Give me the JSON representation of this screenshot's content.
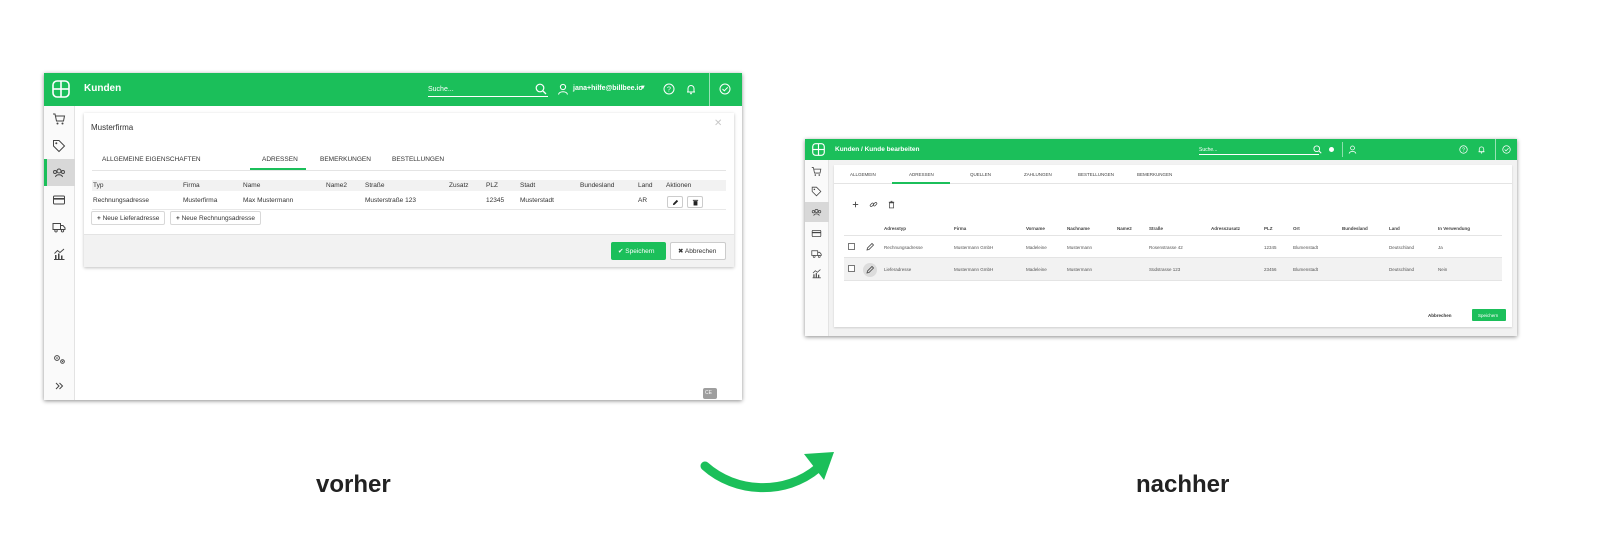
{
  "colors": {
    "brand_green": "#1bbf5a",
    "sidebar_active": "#d8d8d8",
    "header_row": "#f2f2f2"
  },
  "captions": {
    "before": "vorher",
    "after": "nachher"
  },
  "before": {
    "header": {
      "title": "Kunden",
      "search_placeholder": "Suche...",
      "user": "jana+hilfe@billbee.io"
    },
    "sidebar_icons": [
      "cart-icon",
      "tag-icon",
      "customers-icon",
      "credit-card-icon",
      "truck-icon",
      "analytics-icon",
      "settings-icon",
      "expand-icon"
    ],
    "panel": {
      "title": "Musterfirma",
      "tabs": [
        "ALLGEMEINE EIGENSCHAFTEN",
        "ADRESSEN",
        "BEMERKUNGEN",
        "BESTELLUNGEN"
      ],
      "active_tab": "ADRESSEN",
      "columns": [
        "Typ",
        "Firma",
        "Name",
        "Name2",
        "Straße",
        "Zusatz",
        "PLZ",
        "Stadt",
        "Bundesland",
        "Land",
        "Aktionen"
      ],
      "rows": [
        {
          "typ": "Rechnungsadresse",
          "firma": "Musterfirma",
          "name": "Max Mustermann",
          "name2": "",
          "strasse": "Musterstraße 123",
          "zusatz": "",
          "plz": "12345",
          "stadt": "Musterstadt",
          "bundesland": "",
          "land": "AR"
        }
      ],
      "add_delivery": "Neue Lieferadresse",
      "add_invoice": "Neue Rechnungsadresse",
      "save": "Speichern",
      "cancel": "Abbrechen"
    },
    "badge": "CE"
  },
  "after": {
    "header": {
      "title": "Kunden / Kunde bearbeiten",
      "search_placeholder": "Suche..."
    },
    "sidebar_icons": [
      "cart-icon",
      "tag-icon",
      "customers-icon",
      "credit-card-icon",
      "truck-icon",
      "analytics-icon"
    ],
    "tabs": [
      "Allgemein",
      "Adressen",
      "Quellen",
      "Zahlungen",
      "Bestellungen",
      "Bemerkungen"
    ],
    "active_tab": "Adressen",
    "toolbar": [
      "add-icon",
      "link-icon",
      "trash-icon"
    ],
    "columns": [
      "Adresstyp",
      "Firma",
      "Vorname",
      "Nachname",
      "Name2",
      "Straße",
      "Adresszusatz",
      "PLZ",
      "Ort",
      "Bundesland",
      "Land",
      "In Verwendung"
    ],
    "rows": [
      {
        "adresstyp": "Rechnungsadresse",
        "firma": "Mustermann GmbH",
        "vorname": "Madeleine",
        "nachname": "Mustermann",
        "name2": "",
        "strasse": "Rosenstrasse 42",
        "adresszusatz": "",
        "plz": "12345",
        "ort": "Blumenstadt",
        "bundesland": "",
        "land": "Deutschland",
        "in_verwendung": "Ja"
      },
      {
        "adresstyp": "Lieferadresse",
        "firma": "Mustermann GmbH",
        "vorname": "Madeleine",
        "nachname": "Mustermann",
        "name2": "",
        "strasse": "Südstrasse 123",
        "adresszusatz": "",
        "plz": "23456",
        "ort": "Blumenstadt",
        "bundesland": "",
        "land": "Deutschland",
        "in_verwendung": "Nein"
      }
    ],
    "cancel": "Abbrechen",
    "save": "Speichern"
  }
}
